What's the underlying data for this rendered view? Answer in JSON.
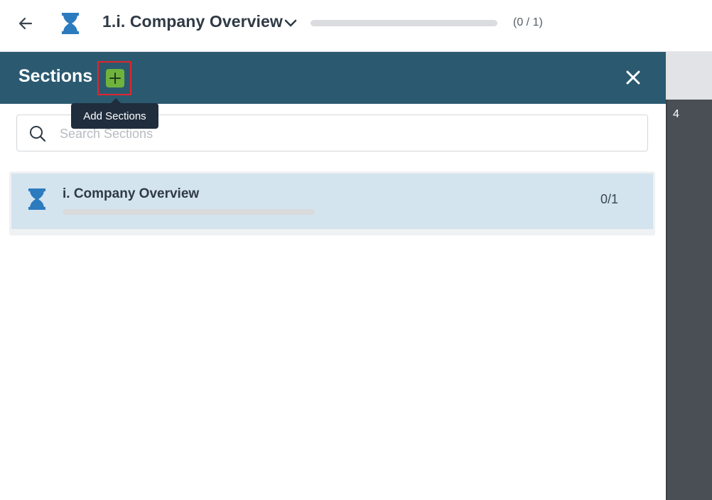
{
  "header": {
    "title": "1.i. Company Overview",
    "progress_text": "(0 / 1)",
    "progress_fraction": 0
  },
  "panel": {
    "title": "Sections",
    "add_tooltip": "Add Sections",
    "search_placeholder": "Search Sections"
  },
  "sections": [
    {
      "name": "i. Company Overview",
      "count": "0/1",
      "progress_fraction": 0
    }
  ],
  "right_strip": {
    "number": "4"
  },
  "colors": {
    "panel_header": "#2b5a70",
    "add_button": "#6fb33d",
    "hourglass": "#2d7bbf",
    "row_selected": "#d3e4ef",
    "highlight_outline": "#e0252b"
  }
}
